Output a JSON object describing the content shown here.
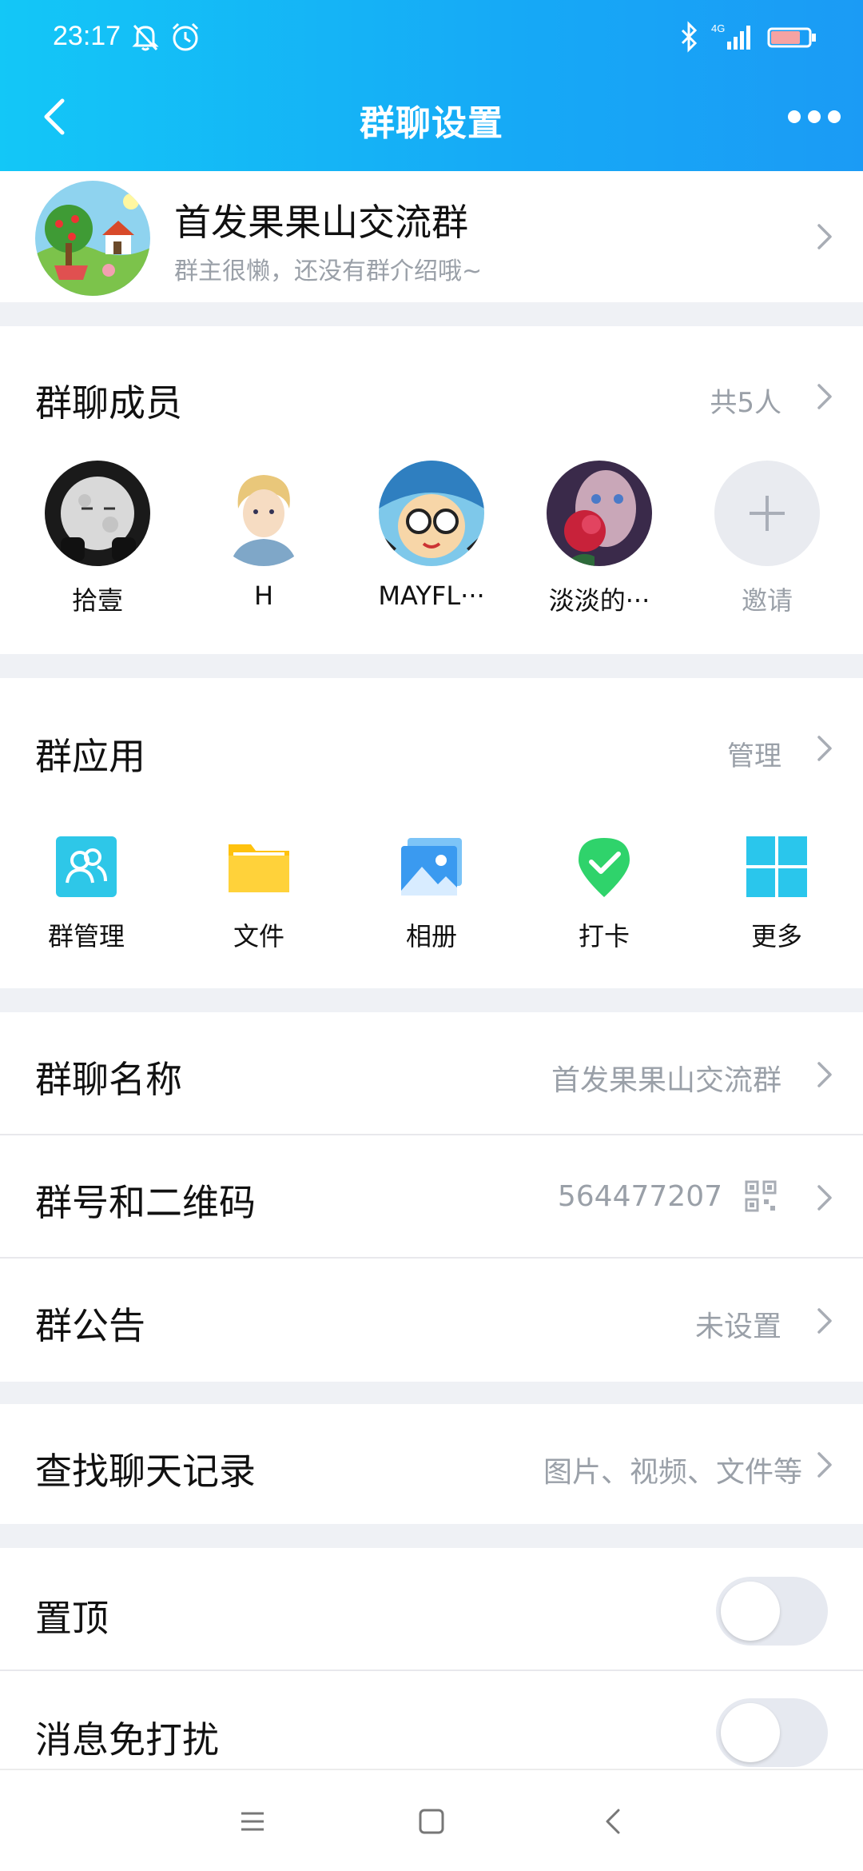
{
  "status": {
    "time": "23:17",
    "network": "4G",
    "battery": "81"
  },
  "header": {
    "title": "群聊设置"
  },
  "group": {
    "name": "首发果果山交流群",
    "desc": "群主很懒，还没有群介绍哦~"
  },
  "members": {
    "title": "群聊成员",
    "count": "共5人",
    "list": [
      {
        "name": "拾壹"
      },
      {
        "name": "H"
      },
      {
        "name": "MAYFL···"
      },
      {
        "name": "淡淡的···"
      }
    ],
    "invite": "邀请"
  },
  "apps": {
    "title": "群应用",
    "manage": "管理",
    "items": [
      {
        "label": "群管理",
        "icon": "group-manage-icon"
      },
      {
        "label": "文件",
        "icon": "folder-icon"
      },
      {
        "label": "相册",
        "icon": "photo-album-icon"
      },
      {
        "label": "打卡",
        "icon": "checkin-icon"
      },
      {
        "label": "更多",
        "icon": "more-apps-icon"
      }
    ]
  },
  "settings": {
    "name_label": "群聊名称",
    "name_value": "首发果果山交流群",
    "number_label": "群号和二维码",
    "number_value": "564477207",
    "notice_label": "群公告",
    "notice_value": "未设置",
    "search_label": "查找聊天记录",
    "search_value": "图片、视频、文件等",
    "pin_label": "置顶",
    "mute_label": "消息免打扰"
  },
  "colors": {
    "header_start": "#13c7f7",
    "header_end": "#1b9bf5",
    "secondary_text": "#9aa0a8"
  }
}
